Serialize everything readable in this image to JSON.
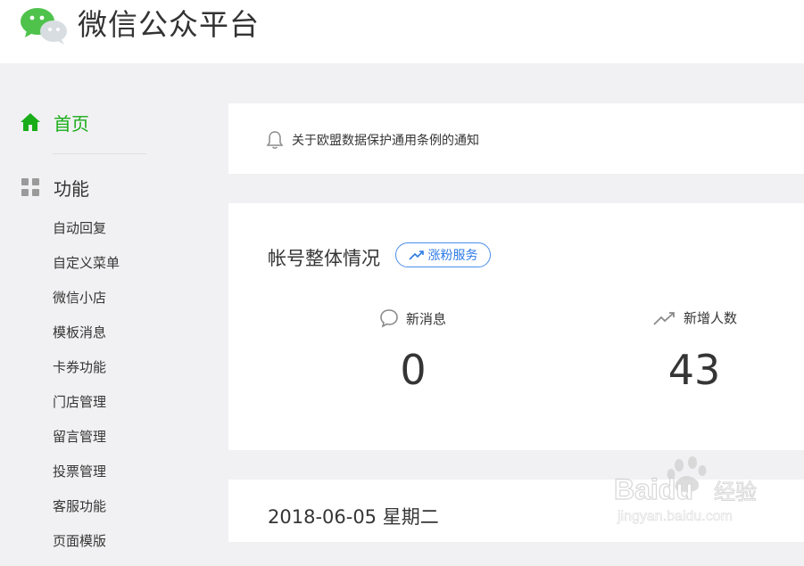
{
  "header": {
    "title": "微信公众平台",
    "logo_icon": "wechat-logo-icon"
  },
  "sidebar": {
    "home": {
      "label": "首页",
      "icon": "home-icon",
      "color": "#1aad19"
    },
    "functions": {
      "label": "功能",
      "icon": "grid-icon"
    },
    "items": [
      {
        "label": "自动回复"
      },
      {
        "label": "自定义菜单"
      },
      {
        "label": "微信小店"
      },
      {
        "label": "模板消息"
      },
      {
        "label": "卡券功能"
      },
      {
        "label": "门店管理"
      },
      {
        "label": "留言管理"
      },
      {
        "label": "投票管理"
      },
      {
        "label": "客服功能"
      },
      {
        "label": "页面模版"
      }
    ]
  },
  "notice": {
    "text": "关于欧盟数据保护通用条例的通知",
    "icon": "bell-icon"
  },
  "overview": {
    "title": "帐号整体情况",
    "growth_button": "涨粉服务",
    "stats": [
      {
        "label": "新消息",
        "value": "0",
        "icon": "chat-bubble-icon"
      },
      {
        "label": "新增人数",
        "value": "43",
        "icon": "trend-up-icon"
      }
    ]
  },
  "date_card": {
    "date": "2018-06-05 星期二"
  },
  "watermark": {
    "brand": "Baidu",
    "suffix": "经验",
    "url": "jingyan.baidu.com"
  },
  "colors": {
    "accent": "#1aad19",
    "link": "#2d7ae6",
    "background": "#f1f1f3"
  }
}
